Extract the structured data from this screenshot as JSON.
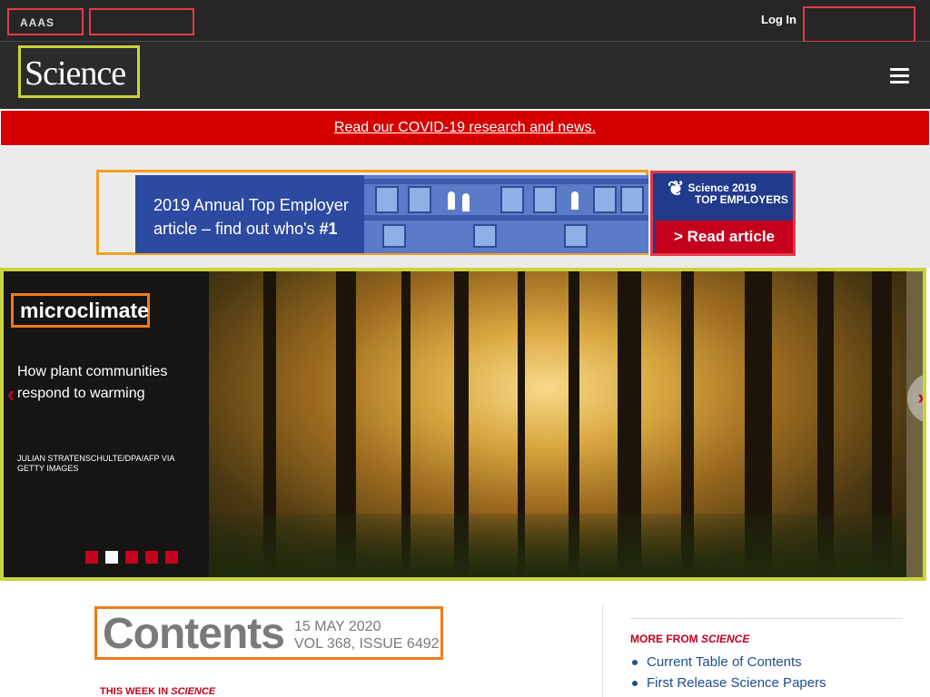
{
  "topbar": {
    "brand_aaas": "AAAS",
    "brand_journals": "",
    "login": "Log In",
    "subscribe": ""
  },
  "masthead": {
    "logo_text": "Science"
  },
  "covid_banner": {
    "link_text": "Read our COVID-19 research and news."
  },
  "ad": {
    "line1": "2019 Annual Top Employer",
    "line2_prefix": "article – find out who's ",
    "line2_bold": "#1",
    "badge_title": "Science 2019",
    "badge_subtitle": "TOP EMPLOYERS",
    "cta_label": "> Read article"
  },
  "hero": {
    "heading": "microclimate",
    "dek": "How plant communities respond to warming",
    "credit": "JULIAN STRATENSCHULTE/DPA/AFP VIA GETTY IMAGES",
    "slides": 5,
    "active_slide": 2
  },
  "contents": {
    "title": "Contents",
    "date": "15 MAY 2020",
    "volume": "VOL 368, ISSUE 6492",
    "this_week_prefix": "THIS WEEK IN ",
    "this_week_italic": "SCIENCE"
  },
  "sidebar": {
    "more_from_prefix": "MORE FROM ",
    "more_from_italic": "SCIENCE",
    "links": [
      "Current Table of Contents",
      "First Release Science Papers"
    ]
  },
  "colors": {
    "accent_red": "#c4001d",
    "link_blue": "#1e4e8c",
    "topbar_bg": "#262626"
  }
}
